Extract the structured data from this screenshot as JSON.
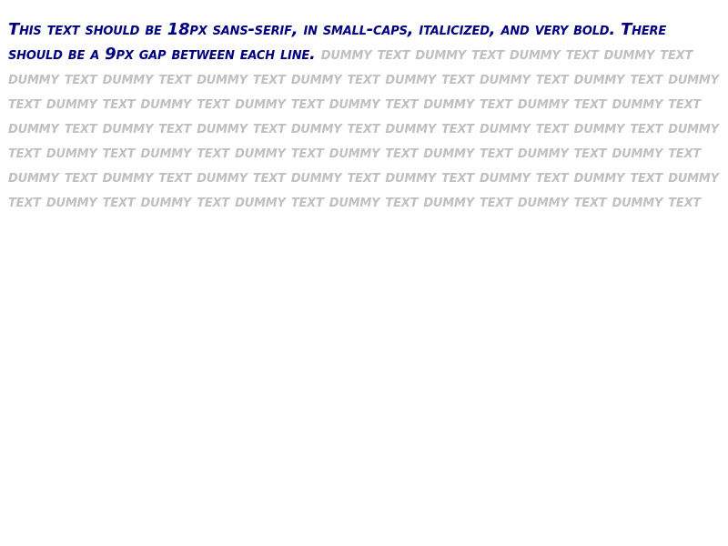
{
  "document": {
    "instruction_text": "This text should be 18px sans-serif, in small-caps, italicized, and very bold. There should be a 9px gap between each line.",
    "dummy_text": "dummy text dummy text dummy text dummy text dummy text dummy text dummy text dummy text dummy text dummy text dummy text dummy text dummy text dummy text dummy text dummy text dummy text dummy text dummy text dummy text dummy text dummy text dummy text dummy text dummy text dummy text dummy text dummy text dummy text dummy text dummy text dummy text dummy text dummy text dummy text dummy text dummy text dummy text dummy text dummy text dummy text dummy text dummy text dummy text dummy text dummy text dummy text dummy text dummy text",
    "colors": {
      "instruction": "#000080",
      "dummy": "#c0c0c0",
      "background": "#ffffff"
    }
  }
}
